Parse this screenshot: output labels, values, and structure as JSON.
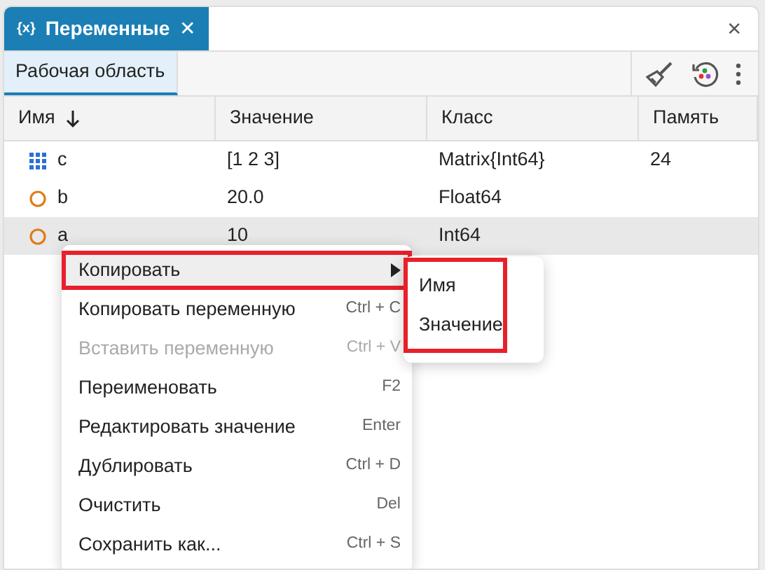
{
  "panel_tab": {
    "icon_text": "{x}",
    "label": "Переменные",
    "close": "✕"
  },
  "panel_close": "×",
  "workspace_tabs": [
    {
      "label": "Рабочая область",
      "selected": true
    }
  ],
  "table": {
    "columns": [
      {
        "label": "Имя",
        "sort_descending": true
      },
      {
        "label": "Значение"
      },
      {
        "label": "Класс"
      },
      {
        "label": "Память"
      }
    ],
    "rows": [
      {
        "kind": "matrix",
        "name": "c",
        "value": "[1 2 3]",
        "class": "Matrix{Int64}",
        "memory": "24",
        "selected": false
      },
      {
        "kind": "scalar",
        "name": "b",
        "value": "20.0",
        "class": "Float64",
        "selected": false
      },
      {
        "kind": "scalar",
        "name": "a",
        "value": "10",
        "class": "Int64",
        "selected": true
      }
    ]
  },
  "context_menu": {
    "items": [
      {
        "label": "Копировать",
        "submenu": true,
        "selected": true,
        "disabled": false,
        "highlighted": true
      },
      {
        "label": "Копировать переменную",
        "shortcut": "Ctrl + C",
        "selected": false,
        "disabled": false
      },
      {
        "label": "Вставить переменную",
        "shortcut": "Ctrl + V",
        "selected": false,
        "disabled": true
      },
      {
        "label": "Переименовать",
        "shortcut": "F2",
        "selected": false,
        "disabled": false
      },
      {
        "label": "Редактировать значение",
        "shortcut": "Enter",
        "selected": false,
        "disabled": false
      },
      {
        "label": "Дублировать",
        "shortcut": "Ctrl + D",
        "selected": false,
        "disabled": false
      },
      {
        "label": "Очистить",
        "shortcut": "Del",
        "selected": false,
        "disabled": false
      },
      {
        "label": "Сохранить как...",
        "shortcut": "Ctrl + S",
        "selected": false,
        "disabled": false
      }
    ]
  },
  "submenu": {
    "highlighted": true,
    "items": [
      {
        "label": "Имя"
      },
      {
        "label": "Значение"
      }
    ]
  }
}
